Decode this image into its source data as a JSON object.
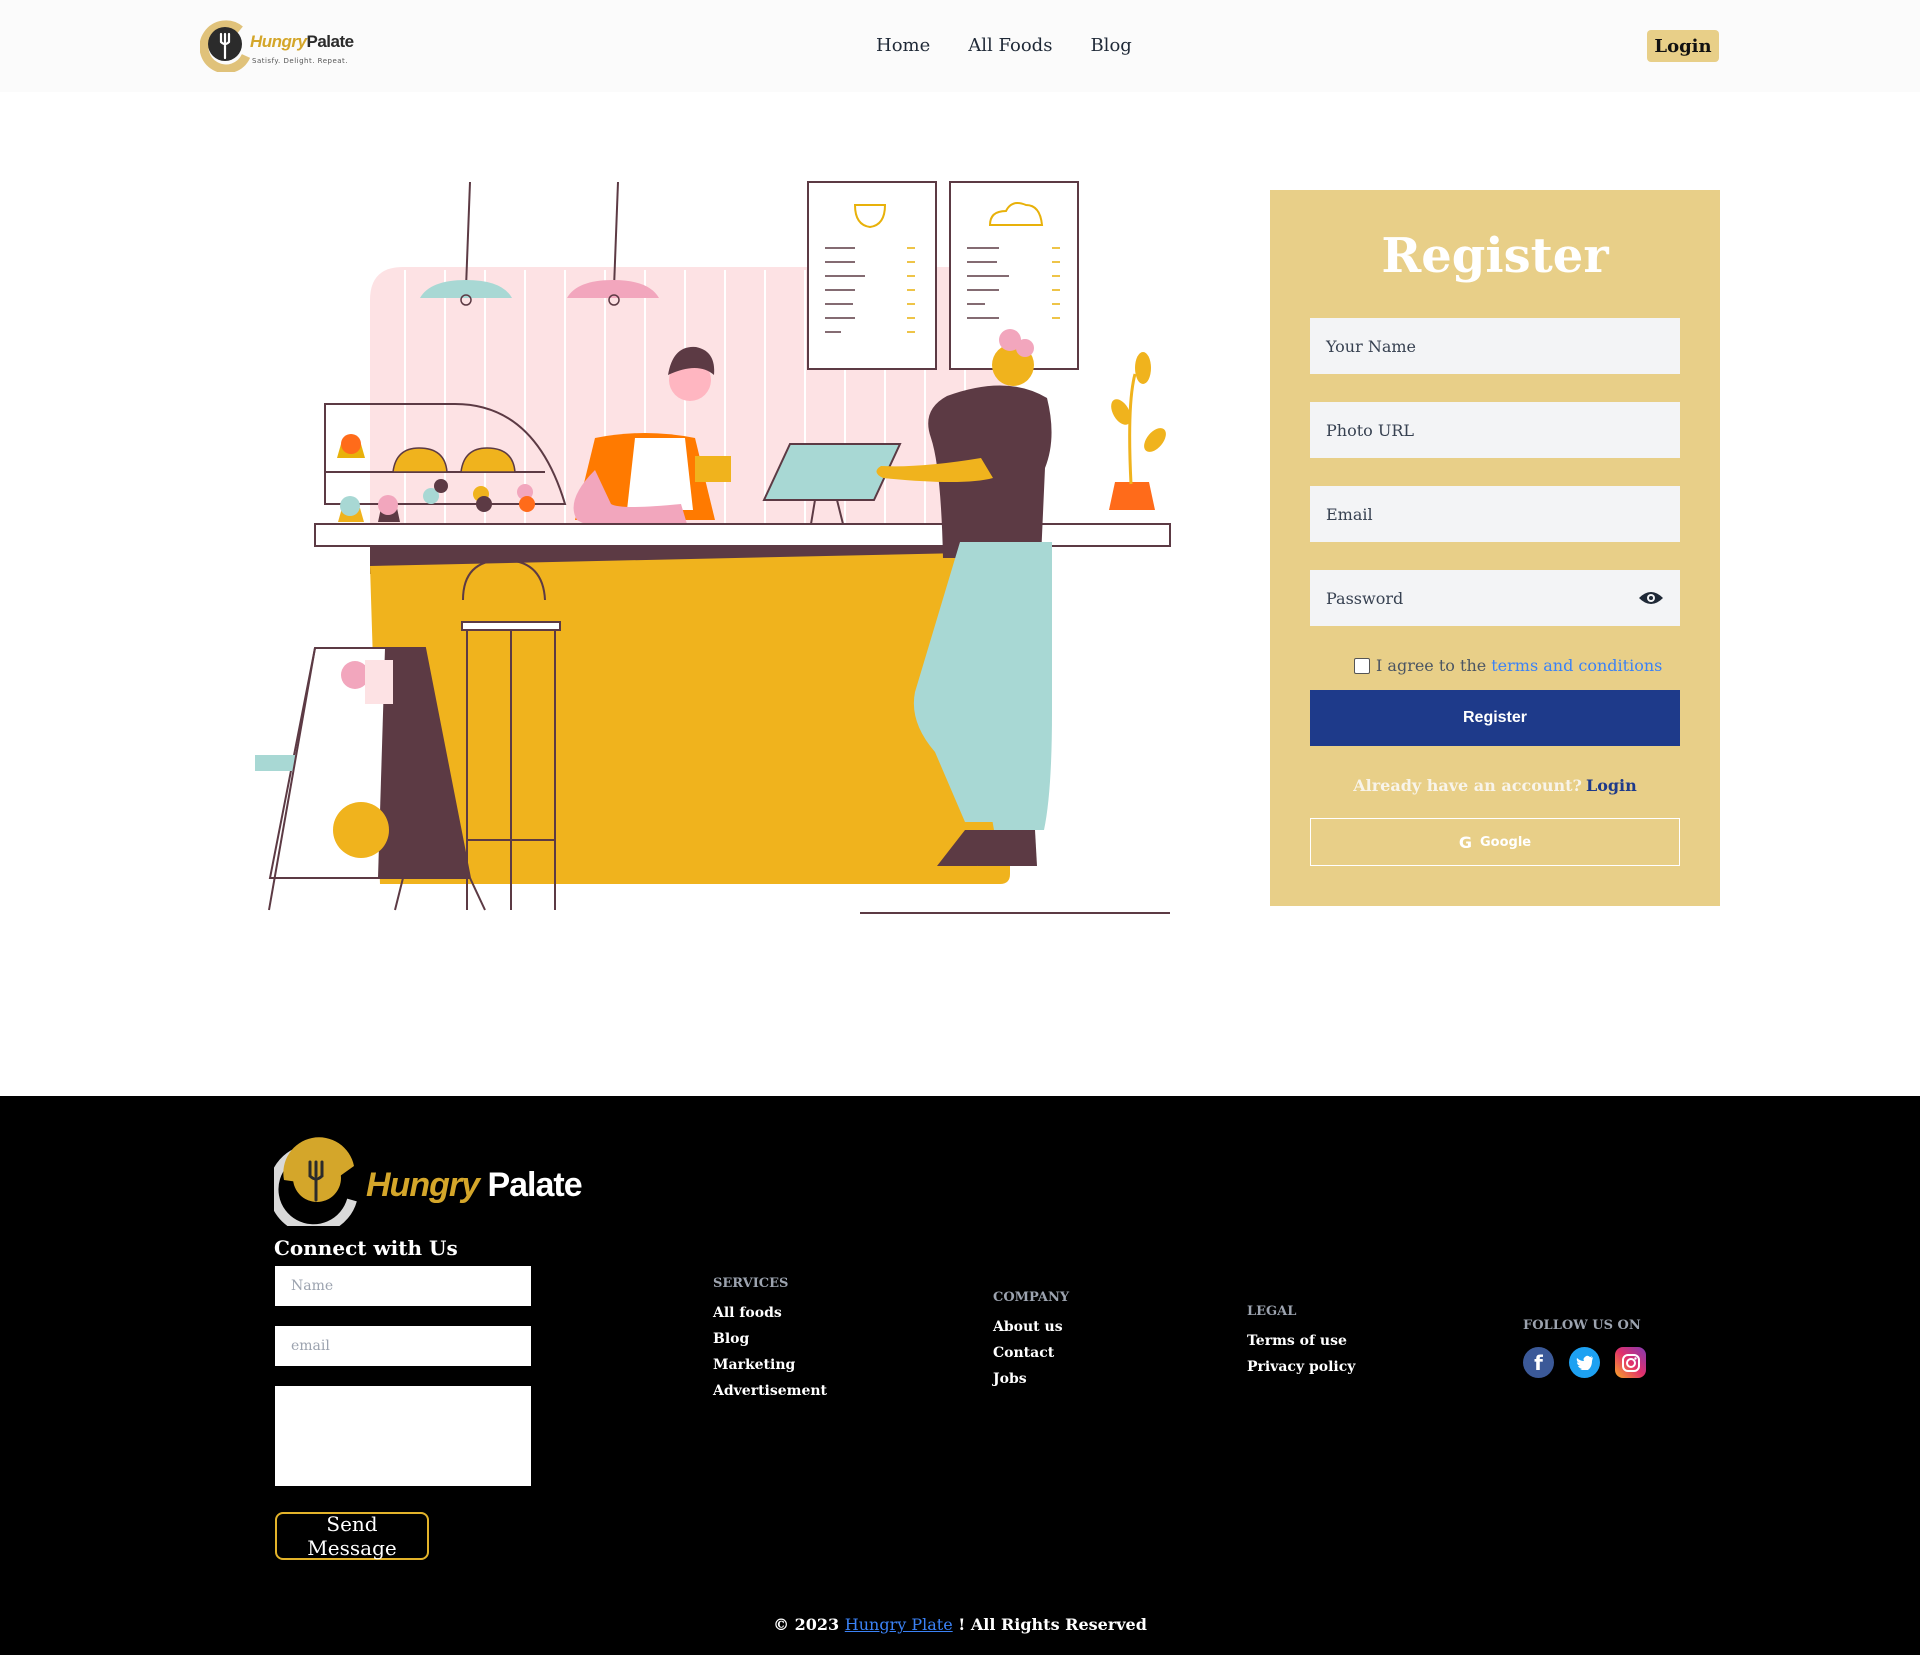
{
  "brand": {
    "name_part1": "Hungry",
    "name_part2": "Palate",
    "tagline": "Satisfy. Delight. Repeat.",
    "accent": "#e8cf88",
    "gold": "#d4a62a"
  },
  "nav": {
    "links": [
      {
        "label": "Home"
      },
      {
        "label": "All Foods"
      },
      {
        "label": "Blog"
      }
    ],
    "login_label": "Login"
  },
  "register": {
    "title": "Register",
    "name_placeholder": "Your Name",
    "photo_placeholder": "Photo URL",
    "email_placeholder": "Email",
    "password_placeholder": "Password",
    "agree_text": "I agree to the",
    "terms_link": "terms and conditions",
    "submit_label": "Register",
    "have_account": "Already have an account?",
    "login_link": "Login",
    "google_label": "Google",
    "submit_color": "#1e3a8a"
  },
  "footer": {
    "connect_title": "Connect with Us",
    "name_placeholder": "Name",
    "email_placeholder": "email",
    "send_label": "Send Message",
    "services": {
      "title": "SERVICES",
      "items": [
        "All foods",
        "Blog",
        "Marketing",
        "Advertisement"
      ]
    },
    "company": {
      "title": "COMPANY",
      "items": [
        "About us",
        "Contact",
        "Jobs"
      ]
    },
    "legal": {
      "title": "LEGAL",
      "items": [
        "Terms of use",
        "Privacy policy"
      ]
    },
    "follow": {
      "title": "FOLLOW US ON",
      "icons": [
        "facebook-icon",
        "twitter-icon",
        "instagram-icon"
      ]
    },
    "copyright_prefix": "© 2023",
    "copyright_link": "Hungry Plate",
    "copyright_suffix": "! All Rights Reserved"
  }
}
